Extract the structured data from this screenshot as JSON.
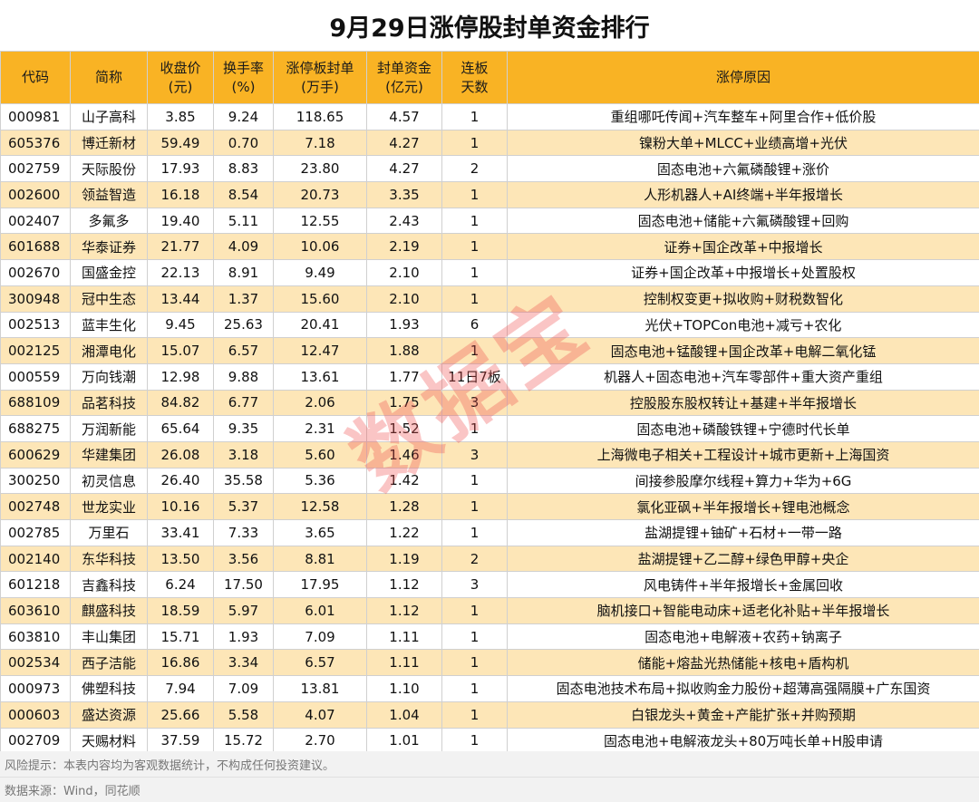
{
  "title": "9月29日涨停股封单资金排行",
  "headers": {
    "code": "代码",
    "name": "简称",
    "close_l1": "收盘价",
    "close_l2": "(元)",
    "turnover_l1": "换手率",
    "turnover_l2": "(%)",
    "seal_l1": "涨停板封单",
    "seal_l2": "(万手)",
    "fund_l1": "封单资金",
    "fund_l2": "(亿元)",
    "days_l1": "连板",
    "days_l2": "天数",
    "reason": "涨停原因"
  },
  "rows": [
    {
      "code": "000981",
      "name": "山子高科",
      "close": "3.85",
      "turnover": "9.24",
      "seal": "118.65",
      "fund": "4.57",
      "days": "1",
      "reason": "重组哪吒传闻+汽车整车+阿里合作+低价股"
    },
    {
      "code": "605376",
      "name": "博迁新材",
      "close": "59.49",
      "turnover": "0.70",
      "seal": "7.18",
      "fund": "4.27",
      "days": "1",
      "reason": "镍粉大单+MLCC+业绩高增+光伏"
    },
    {
      "code": "002759",
      "name": "天际股份",
      "close": "17.93",
      "turnover": "8.83",
      "seal": "23.80",
      "fund": "4.27",
      "days": "2",
      "reason": "固态电池+六氟磷酸锂+涨价"
    },
    {
      "code": "002600",
      "name": "领益智造",
      "close": "16.18",
      "turnover": "8.54",
      "seal": "20.73",
      "fund": "3.35",
      "days": "1",
      "reason": "人形机器人+AI终端+半年报增长"
    },
    {
      "code": "002407",
      "name": "多氟多",
      "close": "19.40",
      "turnover": "5.11",
      "seal": "12.55",
      "fund": "2.43",
      "days": "1",
      "reason": "固态电池+储能+六氟磷酸锂+回购"
    },
    {
      "code": "601688",
      "name": "华泰证券",
      "close": "21.77",
      "turnover": "4.09",
      "seal": "10.06",
      "fund": "2.19",
      "days": "1",
      "reason": "证券+国企改革+中报增长"
    },
    {
      "code": "002670",
      "name": "国盛金控",
      "close": "22.13",
      "turnover": "8.91",
      "seal": "9.49",
      "fund": "2.10",
      "days": "1",
      "reason": "证券+国企改革+中报增长+处置股权"
    },
    {
      "code": "300948",
      "name": "冠中生态",
      "close": "13.44",
      "turnover": "1.37",
      "seal": "15.60",
      "fund": "2.10",
      "days": "1",
      "reason": "控制权变更+拟收购+财税数智化"
    },
    {
      "code": "002513",
      "name": "蓝丰生化",
      "close": "9.45",
      "turnover": "25.63",
      "seal": "20.41",
      "fund": "1.93",
      "days": "6",
      "reason": "光伏+TOPCon电池+减亏+农化"
    },
    {
      "code": "002125",
      "name": "湘潭电化",
      "close": "15.07",
      "turnover": "6.57",
      "seal": "12.47",
      "fund": "1.88",
      "days": "1",
      "reason": "固态电池+锰酸锂+国企改革+电解二氧化锰"
    },
    {
      "code": "000559",
      "name": "万向钱潮",
      "close": "12.98",
      "turnover": "9.88",
      "seal": "13.61",
      "fund": "1.77",
      "days": "11日7板",
      "reason": "机器人+固态电池+汽车零部件+重大资产重组"
    },
    {
      "code": "688109",
      "name": "品茗科技",
      "close": "84.82",
      "turnover": "6.77",
      "seal": "2.06",
      "fund": "1.75",
      "days": "3",
      "reason": "控股股东股权转让+基建+半年报增长"
    },
    {
      "code": "688275",
      "name": "万润新能",
      "close": "65.64",
      "turnover": "9.35",
      "seal": "2.31",
      "fund": "1.52",
      "days": "1",
      "reason": "固态电池+磷酸铁锂+宁德时代长单"
    },
    {
      "code": "600629",
      "name": "华建集团",
      "close": "26.08",
      "turnover": "3.18",
      "seal": "5.60",
      "fund": "1.46",
      "days": "3",
      "reason": "上海微电子相关+工程设计+城市更新+上海国资"
    },
    {
      "code": "300250",
      "name": "初灵信息",
      "close": "26.40",
      "turnover": "35.58",
      "seal": "5.36",
      "fund": "1.42",
      "days": "1",
      "reason": "间接参股摩尔线程+算力+华为+6G"
    },
    {
      "code": "002748",
      "name": "世龙实业",
      "close": "10.16",
      "turnover": "5.37",
      "seal": "12.58",
      "fund": "1.28",
      "days": "1",
      "reason": "氯化亚砜+半年报增长+锂电池概念"
    },
    {
      "code": "002785",
      "name": "万里石",
      "close": "33.41",
      "turnover": "7.33",
      "seal": "3.65",
      "fund": "1.22",
      "days": "1",
      "reason": "盐湖提锂+铀矿+石材+一带一路"
    },
    {
      "code": "002140",
      "name": "东华科技",
      "close": "13.50",
      "turnover": "3.56",
      "seal": "8.81",
      "fund": "1.19",
      "days": "2",
      "reason": "盐湖提锂+乙二醇+绿色甲醇+央企"
    },
    {
      "code": "601218",
      "name": "吉鑫科技",
      "close": "6.24",
      "turnover": "17.50",
      "seal": "17.95",
      "fund": "1.12",
      "days": "3",
      "reason": "风电铸件+半年报增长+金属回收"
    },
    {
      "code": "603610",
      "name": "麒盛科技",
      "close": "18.59",
      "turnover": "5.97",
      "seal": "6.01",
      "fund": "1.12",
      "days": "1",
      "reason": "脑机接口+智能电动床+适老化补贴+半年报增长"
    },
    {
      "code": "603810",
      "name": "丰山集团",
      "close": "15.71",
      "turnover": "1.93",
      "seal": "7.09",
      "fund": "1.11",
      "days": "1",
      "reason": "固态电池+电解液+农药+钠离子"
    },
    {
      "code": "002534",
      "name": "西子洁能",
      "close": "16.86",
      "turnover": "3.34",
      "seal": "6.57",
      "fund": "1.11",
      "days": "1",
      "reason": "储能+熔盐光热储能+核电+盾构机"
    },
    {
      "code": "000973",
      "name": "佛塑科技",
      "close": "7.94",
      "turnover": "7.09",
      "seal": "13.81",
      "fund": "1.10",
      "days": "1",
      "reason": "固态电池技术布局+拟收购金力股份+超薄高强隔膜+广东国资"
    },
    {
      "code": "000603",
      "name": "盛达资源",
      "close": "25.66",
      "turnover": "5.58",
      "seal": "4.07",
      "fund": "1.04",
      "days": "1",
      "reason": "白银龙头+黄金+产能扩张+并购预期"
    },
    {
      "code": "002709",
      "name": "天赐材料",
      "close": "37.59",
      "turnover": "15.72",
      "seal": "2.70",
      "fund": "1.01",
      "days": "1",
      "reason": "固态电池+电解液龙头+80万吨长单+H股申请"
    }
  ],
  "footer": {
    "risk": "风险提示：本表内容均为客观数据统计，不构成任何投资建议。",
    "source": "数据来源：Wind，同花顺"
  },
  "watermark": "数据宝",
  "colors": {
    "header_bg": "#f9b324",
    "alt_row_bg": "#fde6b7",
    "watermark": "#f05050"
  }
}
